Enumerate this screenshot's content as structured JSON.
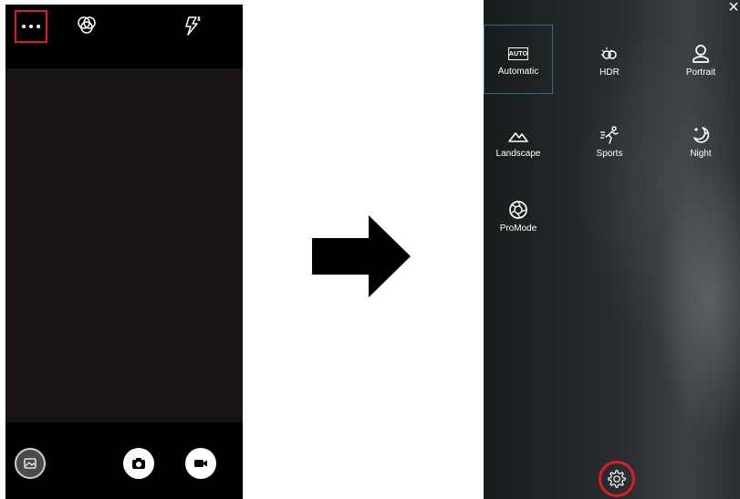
{
  "left_screen": {
    "top_bar": {
      "more_button": {
        "icon": "more-dots-icon",
        "highlight_color": "#e01b1b"
      },
      "filter_button": {
        "icon": "filter-circles-icon"
      },
      "flash_button": {
        "icon": "flash-auto-icon"
      }
    },
    "viewfinder": {
      "color": "#1a1314"
    },
    "bottom_bar": {
      "gallery_button": {
        "icon": "gallery-icon"
      },
      "shutter_button": {
        "icon": "camera-icon"
      },
      "video_button": {
        "icon": "video-camera-icon"
      }
    }
  },
  "arrow": {
    "icon": "right-arrow-icon"
  },
  "right_screen": {
    "close_label": "×",
    "auto_badge": "AUTO",
    "modes": [
      {
        "label": "Automatic",
        "icon": "auto-icon",
        "selected": true
      },
      {
        "label": "HDR",
        "icon": "hdr-icon"
      },
      {
        "label": "Portrait",
        "icon": "portrait-icon"
      },
      {
        "label": "Landscape",
        "icon": "landscape-icon"
      },
      {
        "label": "Sports",
        "icon": "sports-icon"
      },
      {
        "label": "Night",
        "icon": "night-icon"
      },
      {
        "label": "ProMode",
        "icon": "aperture-icon"
      }
    ],
    "settings_button": {
      "icon": "gear-icon",
      "highlight_color": "#e01b1b"
    },
    "selection_color": "#2b6f8f"
  }
}
